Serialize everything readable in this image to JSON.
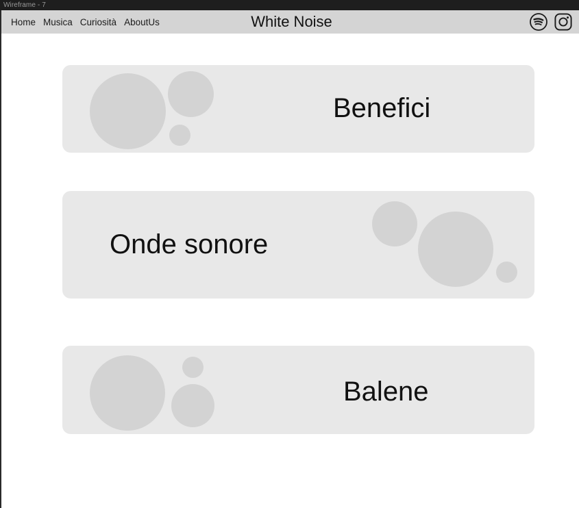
{
  "window": {
    "title": "Wireframe - 7"
  },
  "header": {
    "title": "White Noise",
    "nav": [
      {
        "label": "Home"
      },
      {
        "label": "Musica"
      },
      {
        "label": "Curiosità"
      },
      {
        "label": "AboutUs"
      }
    ],
    "social": [
      {
        "icon": "spotify-icon",
        "name": "Spotify"
      },
      {
        "icon": "instagram-icon",
        "name": "Instagram"
      }
    ]
  },
  "main": {
    "cards": [
      {
        "label": "Benefici",
        "image_side": "left"
      },
      {
        "label": "Onde sonore",
        "image_side": "right"
      },
      {
        "label": "Balene",
        "image_side": "left"
      }
    ]
  },
  "colors": {
    "titlebar": "#1e1e1e",
    "titlebar_text": "#9a9a9a",
    "header_bg": "#d4d4d4",
    "page_bg": "#ffffff",
    "card_bg": "#e8e8e8",
    "blob": "#d3d3d3",
    "text": "#111111"
  }
}
